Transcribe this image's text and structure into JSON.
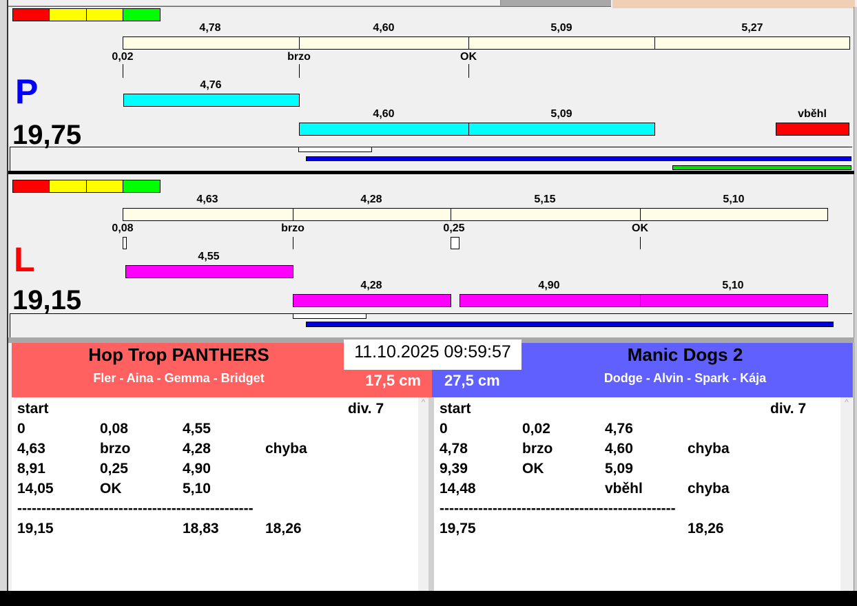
{
  "colors": {
    "red": "#ff0000",
    "yellow": "#ffff00",
    "green": "#00ff00",
    "left_team": "#ff6060",
    "right_team": "#6060ff"
  },
  "panel_p": {
    "letter": "P",
    "time": "19,75",
    "top_segments": [
      "4,78",
      "4,60",
      "5,09",
      "5,27"
    ],
    "markers": [
      "0,02",
      "brzo",
      "OK"
    ],
    "run1": [
      "4,76"
    ],
    "run2": [
      "4,60",
      "5,09"
    ],
    "fault": "vběhl"
  },
  "panel_l": {
    "letter": "L",
    "time": "19,15",
    "top_segments": [
      "4,63",
      "4,28",
      "5,15",
      "5,10"
    ],
    "markers": [
      "0,08",
      "brzo",
      "0,25",
      "OK"
    ],
    "run1": [
      "4,55"
    ],
    "run2": [
      "4,28",
      "4,90",
      "5,10"
    ]
  },
  "datetime": "11.10.2025 09:59:57",
  "left_team": {
    "name": "Hop Trop PANTHERS",
    "dogs": "Fler - Aina - Gemma - Bridget",
    "height": "17,5 cm",
    "rows": [
      [
        "start",
        "",
        "",
        "",
        "div.  7"
      ],
      [
        "0",
        "0,08",
        "4,55",
        "",
        ""
      ],
      [
        "4,63",
        "brzo",
        "4,28",
        "chyba",
        ""
      ],
      [
        "8,91",
        "0,25",
        "4,90",
        "",
        ""
      ],
      [
        "14,05",
        "OK",
        "5,10",
        "",
        ""
      ],
      [
        "-------------------------------------------------",
        "",
        "",
        "",
        ""
      ],
      [
        "19,15",
        "",
        "18,83",
        "18,26",
        ""
      ]
    ]
  },
  "right_team": {
    "name": "Manic Dogs 2",
    "dogs": "Dodge - Alvin - Spark - Kája",
    "height": "27,5 cm",
    "rows": [
      [
        "start",
        "",
        "",
        "",
        "div.  7"
      ],
      [
        "0",
        "0,02",
        "4,76",
        "",
        ""
      ],
      [
        "4,78",
        "brzo",
        "4,60",
        "chyba",
        ""
      ],
      [
        "9,39",
        "OK",
        "5,09",
        "",
        ""
      ],
      [
        "14,48",
        "",
        "vběhl",
        "chyba",
        ""
      ],
      [
        "-------------------------------------------------",
        "",
        "",
        "",
        ""
      ],
      [
        "19,75",
        "",
        "",
        "18,26",
        ""
      ]
    ]
  }
}
